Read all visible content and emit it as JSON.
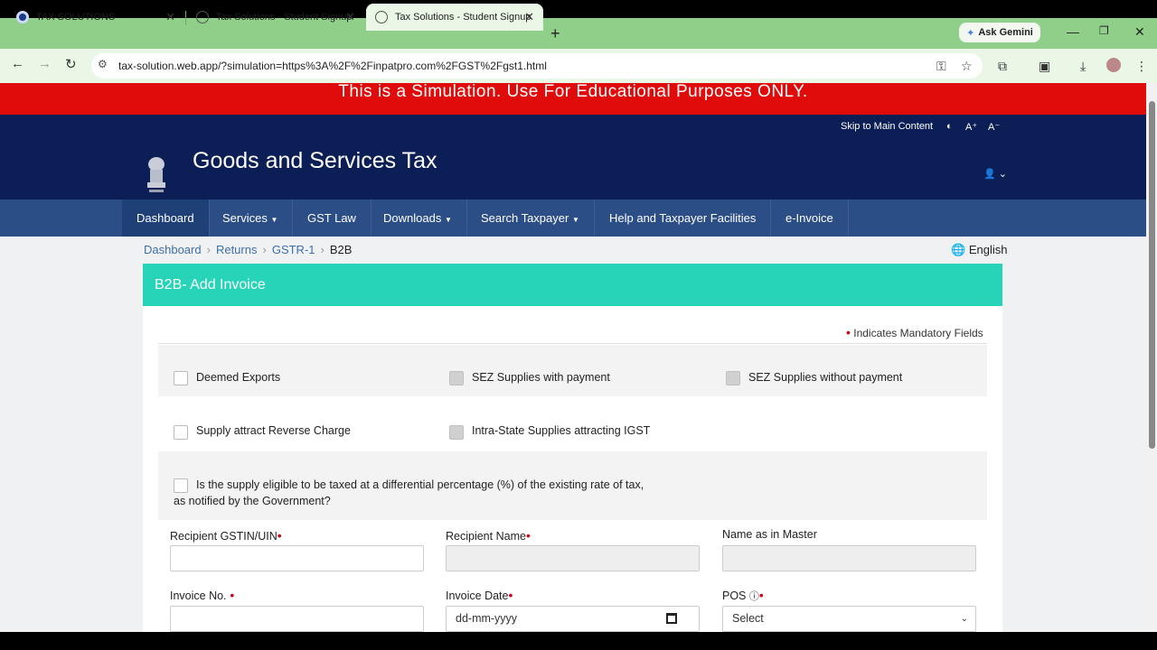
{
  "browser": {
    "tabs": [
      {
        "title": "TAX SOLUTIONS",
        "active": false
      },
      {
        "title": "Tax Solutions - Student Signup",
        "active": false
      },
      {
        "title": "Tax Solutions - Student Signup",
        "active": true
      }
    ],
    "gemini_label": "Ask Gemini",
    "url": "tax-solution.web.app/?simulation=https%3A%2F%2Finpatpro.com%2FGST%2Fgst1.html"
  },
  "banner": {
    "text": "This is a Simulation. Use For Educational Purposes ONLY."
  },
  "accessibility": {
    "skip": "Skip to Main Content",
    "font_plus": "A⁺",
    "font_minus": "A⁻"
  },
  "header": {
    "title": "Goods and Services Tax"
  },
  "nav": {
    "items": [
      "Dashboard",
      "Services",
      "GST Law",
      "Downloads",
      "Search Taxpayer",
      "Help and Taxpayer Facilities",
      "e-Invoice"
    ]
  },
  "breadcrumb": {
    "items": [
      "Dashboard",
      "Returns",
      "GSTR-1"
    ],
    "current": "B2B"
  },
  "language": "English",
  "form": {
    "heading": "B2B- Add Invoice",
    "mandatory_note": "Indicates Mandatory Fields",
    "checkboxes": {
      "deemed_exports": "Deemed Exports",
      "sez_with": "SEZ Supplies with payment",
      "sez_without": "SEZ Supplies without payment",
      "reverse_charge": "Supply attract Reverse Charge",
      "intra_igst": "Intra-State Supplies attracting IGST",
      "differential_line1": "Is the supply eligible to be taxed at a differential percentage (%) of the existing rate of tax,",
      "differential_line2": "as notified by the Government?"
    },
    "labels": {
      "gstin": "Recipient GSTIN/UIN",
      "recipient_name": "Recipient Name",
      "master_name": "Name as in Master",
      "invoice_no": "Invoice No.",
      "invoice_date": "Invoice Date",
      "pos": "POS"
    },
    "invoice_date_placeholder": "dd-mm-yyyy",
    "pos_selected": "Select"
  },
  "colors": {
    "banner": "#e00b0b",
    "header": "#0b1e55",
    "nav": "#2c4e86",
    "card_head": "#27d4b8"
  }
}
